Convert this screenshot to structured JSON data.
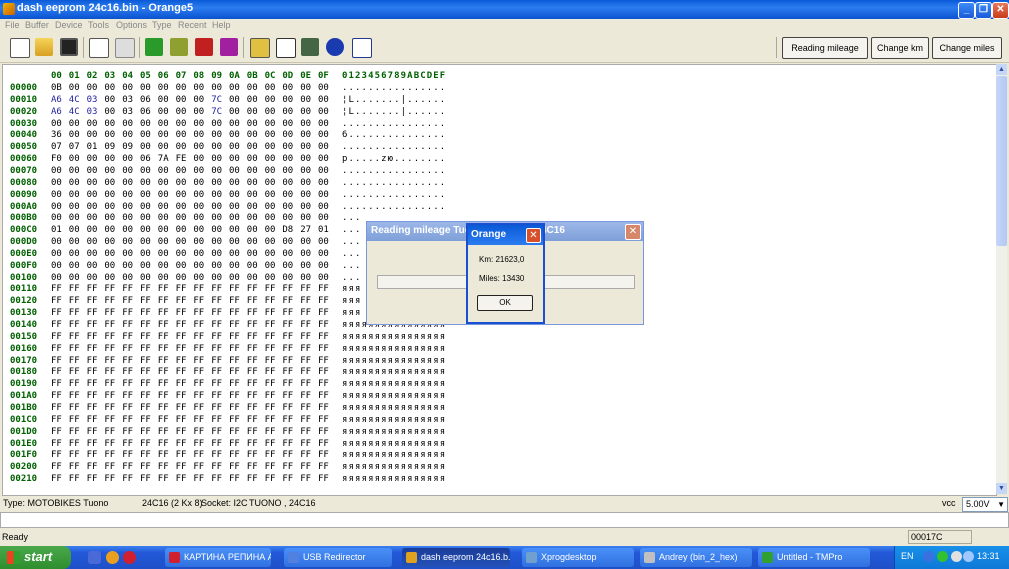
{
  "window": {
    "title": "dash eeprom 24c16.bin - Orange5"
  },
  "menu": [
    "File",
    "Buffer",
    "Device",
    "Tools",
    "Options",
    "Type",
    "Recent",
    "Help"
  ],
  "toolbar": {
    "reading_mileage": "Reading mileage",
    "change_km": "Change km",
    "change_miles": "Change miles"
  },
  "hex": {
    "header_cols": [
      "00",
      "01",
      "02",
      "03",
      "04",
      "05",
      "06",
      "07",
      "08",
      "09",
      "0A",
      "0B",
      "0C",
      "0D",
      "0E",
      "0F"
    ],
    "header_ascii": "0123456789ABCDEF",
    "rows": [
      {
        "addr": "00000",
        "bytes": [
          "0B",
          "00",
          "00",
          "00",
          "00",
          "00",
          "00",
          "00",
          "00",
          "00",
          "00",
          "00",
          "00",
          "00",
          "00",
          "00"
        ],
        "ascii": "................"
      },
      {
        "addr": "00010",
        "bytes": [
          "A6",
          "4C",
          "03",
          "00",
          "03",
          "06",
          "00",
          "00",
          "00",
          "7C",
          "00",
          "00",
          "00",
          "00",
          "00",
          "00"
        ],
        "ascii": "¦L.......|......"
      },
      {
        "addr": "00020",
        "bytes": [
          "A6",
          "4C",
          "03",
          "00",
          "03",
          "06",
          "00",
          "00",
          "00",
          "7C",
          "00",
          "00",
          "00",
          "00",
          "00",
          "00"
        ],
        "ascii": "¦L.......|......"
      },
      {
        "addr": "00030",
        "bytes": [
          "00",
          "00",
          "00",
          "00",
          "00",
          "00",
          "00",
          "00",
          "00",
          "00",
          "00",
          "00",
          "00",
          "00",
          "00",
          "00"
        ],
        "ascii": "................"
      },
      {
        "addr": "00040",
        "bytes": [
          "36",
          "00",
          "00",
          "00",
          "00",
          "00",
          "00",
          "00",
          "00",
          "00",
          "00",
          "00",
          "00",
          "00",
          "00",
          "00"
        ],
        "ascii": "6..............."
      },
      {
        "addr": "00050",
        "bytes": [
          "07",
          "07",
          "01",
          "09",
          "09",
          "00",
          "00",
          "00",
          "00",
          "00",
          "00",
          "00",
          "00",
          "00",
          "00",
          "00"
        ],
        "ascii": "................"
      },
      {
        "addr": "00060",
        "bytes": [
          "F0",
          "00",
          "00",
          "00",
          "00",
          "06",
          "7A",
          "FE",
          "00",
          "00",
          "00",
          "00",
          "00",
          "00",
          "00",
          "00"
        ],
        "ascii": "p.....zю........"
      },
      {
        "addr": "00070",
        "bytes": [
          "00",
          "00",
          "00",
          "00",
          "00",
          "00",
          "00",
          "00",
          "00",
          "00",
          "00",
          "00",
          "00",
          "00",
          "00",
          "00"
        ],
        "ascii": "................"
      },
      {
        "addr": "00080",
        "bytes": [
          "00",
          "00",
          "00",
          "00",
          "00",
          "00",
          "00",
          "00",
          "00",
          "00",
          "00",
          "00",
          "00",
          "00",
          "00",
          "00"
        ],
        "ascii": "................"
      },
      {
        "addr": "00090",
        "bytes": [
          "00",
          "00",
          "00",
          "00",
          "00",
          "00",
          "00",
          "00",
          "00",
          "00",
          "00",
          "00",
          "00",
          "00",
          "00",
          "00"
        ],
        "ascii": "................"
      },
      {
        "addr": "000A0",
        "bytes": [
          "00",
          "00",
          "00",
          "00",
          "00",
          "00",
          "00",
          "00",
          "00",
          "00",
          "00",
          "00",
          "00",
          "00",
          "00",
          "00"
        ],
        "ascii": "................"
      },
      {
        "addr": "000B0",
        "bytes": [
          "00",
          "00",
          "00",
          "00",
          "00",
          "00",
          "00",
          "00",
          "00",
          "00",
          "00",
          "00",
          "00",
          "00",
          "00",
          "00"
        ],
        "ascii": "..."
      },
      {
        "addr": "000C0",
        "bytes": [
          "01",
          "00",
          "00",
          "00",
          "00",
          "00",
          "00",
          "00",
          "00",
          "00",
          "00",
          "00",
          "00",
          "D8",
          "27",
          "01"
        ],
        "ascii": "..."
      },
      {
        "addr": "000D0",
        "bytes": [
          "00",
          "00",
          "00",
          "00",
          "00",
          "00",
          "00",
          "00",
          "00",
          "00",
          "00",
          "00",
          "00",
          "00",
          "00",
          "00"
        ],
        "ascii": "..."
      },
      {
        "addr": "000E0",
        "bytes": [
          "00",
          "00",
          "00",
          "00",
          "00",
          "00",
          "00",
          "00",
          "00",
          "00",
          "00",
          "00",
          "00",
          "00",
          "00",
          "00"
        ],
        "ascii": "..."
      },
      {
        "addr": "000F0",
        "bytes": [
          "00",
          "00",
          "00",
          "00",
          "00",
          "00",
          "00",
          "00",
          "00",
          "00",
          "00",
          "00",
          "00",
          "00",
          "00",
          "00"
        ],
        "ascii": "..."
      },
      {
        "addr": "00100",
        "bytes": [
          "00",
          "00",
          "00",
          "00",
          "00",
          "00",
          "00",
          "00",
          "00",
          "00",
          "00",
          "00",
          "00",
          "00",
          "00",
          "00"
        ],
        "ascii": "..."
      },
      {
        "addr": "00110",
        "bytes": [
          "FF",
          "FF",
          "FF",
          "FF",
          "FF",
          "FF",
          "FF",
          "FF",
          "FF",
          "FF",
          "FF",
          "FF",
          "FF",
          "FF",
          "FF",
          "FF"
        ],
        "ascii": "яяя"
      },
      {
        "addr": "00120",
        "bytes": [
          "FF",
          "FF",
          "FF",
          "FF",
          "FF",
          "FF",
          "FF",
          "FF",
          "FF",
          "FF",
          "FF",
          "FF",
          "FF",
          "FF",
          "FF",
          "FF"
        ],
        "ascii": "яяя"
      },
      {
        "addr": "00130",
        "bytes": [
          "FF",
          "FF",
          "FF",
          "FF",
          "FF",
          "FF",
          "FF",
          "FF",
          "FF",
          "FF",
          "FF",
          "FF",
          "FF",
          "FF",
          "FF",
          "FF"
        ],
        "ascii": "яяя"
      },
      {
        "addr": "00140",
        "bytes": [
          "FF",
          "FF",
          "FF",
          "FF",
          "FF",
          "FF",
          "FF",
          "FF",
          "FF",
          "FF",
          "FF",
          "FF",
          "FF",
          "FF",
          "FF",
          "FF"
        ],
        "ascii": "яяяяяяяяяяяяяяяя"
      },
      {
        "addr": "00150",
        "bytes": [
          "FF",
          "FF",
          "FF",
          "FF",
          "FF",
          "FF",
          "FF",
          "FF",
          "FF",
          "FF",
          "FF",
          "FF",
          "FF",
          "FF",
          "FF",
          "FF"
        ],
        "ascii": "яяяяяяяяяяяяяяяя"
      },
      {
        "addr": "00160",
        "bytes": [
          "FF",
          "FF",
          "FF",
          "FF",
          "FF",
          "FF",
          "FF",
          "FF",
          "FF",
          "FF",
          "FF",
          "FF",
          "FF",
          "FF",
          "FF",
          "FF"
        ],
        "ascii": "яяяяяяяяяяяяяяяя"
      },
      {
        "addr": "00170",
        "bytes": [
          "FF",
          "FF",
          "FF",
          "FF",
          "FF",
          "FF",
          "FF",
          "FF",
          "FF",
          "FF",
          "FF",
          "FF",
          "FF",
          "FF",
          "FF",
          "FF"
        ],
        "ascii": "яяяяяяяяяяяяяяяя"
      },
      {
        "addr": "00180",
        "bytes": [
          "FF",
          "FF",
          "FF",
          "FF",
          "FF",
          "FF",
          "FF",
          "FF",
          "FF",
          "FF",
          "FF",
          "FF",
          "FF",
          "FF",
          "FF",
          "FF"
        ],
        "ascii": "яяяяяяяяяяяяяяяя"
      },
      {
        "addr": "00190",
        "bytes": [
          "FF",
          "FF",
          "FF",
          "FF",
          "FF",
          "FF",
          "FF",
          "FF",
          "FF",
          "FF",
          "FF",
          "FF",
          "FF",
          "FF",
          "FF",
          "FF"
        ],
        "ascii": "яяяяяяяяяяяяяяяя"
      },
      {
        "addr": "001A0",
        "bytes": [
          "FF",
          "FF",
          "FF",
          "FF",
          "FF",
          "FF",
          "FF",
          "FF",
          "FF",
          "FF",
          "FF",
          "FF",
          "FF",
          "FF",
          "FF",
          "FF"
        ],
        "ascii": "яяяяяяяяяяяяяяяя"
      },
      {
        "addr": "001B0",
        "bytes": [
          "FF",
          "FF",
          "FF",
          "FF",
          "FF",
          "FF",
          "FF",
          "FF",
          "FF",
          "FF",
          "FF",
          "FF",
          "FF",
          "FF",
          "FF",
          "FF"
        ],
        "ascii": "яяяяяяяяяяяяяяяя"
      },
      {
        "addr": "001C0",
        "bytes": [
          "FF",
          "FF",
          "FF",
          "FF",
          "FF",
          "FF",
          "FF",
          "FF",
          "FF",
          "FF",
          "FF",
          "FF",
          "FF",
          "FF",
          "FF",
          "FF"
        ],
        "ascii": "яяяяяяяяяяяяяяяя"
      },
      {
        "addr": "001D0",
        "bytes": [
          "FF",
          "FF",
          "FF",
          "FF",
          "FF",
          "FF",
          "FF",
          "FF",
          "FF",
          "FF",
          "FF",
          "FF",
          "FF",
          "FF",
          "FF",
          "FF"
        ],
        "ascii": "яяяяяяяяяяяяяяяя"
      },
      {
        "addr": "001E0",
        "bytes": [
          "FF",
          "FF",
          "FF",
          "FF",
          "FF",
          "FF",
          "FF",
          "FF",
          "FF",
          "FF",
          "FF",
          "FF",
          "FF",
          "FF",
          "FF",
          "FF"
        ],
        "ascii": "яяяяяяяяяяяяяяяя"
      },
      {
        "addr": "001F0",
        "bytes": [
          "FF",
          "FF",
          "FF",
          "FF",
          "FF",
          "FF",
          "FF",
          "FF",
          "FF",
          "FF",
          "FF",
          "FF",
          "FF",
          "FF",
          "FF",
          "FF"
        ],
        "ascii": "яяяяяяяяяяяяяяяя"
      },
      {
        "addr": "00200",
        "bytes": [
          "FF",
          "FF",
          "FF",
          "FF",
          "FF",
          "FF",
          "FF",
          "FF",
          "FF",
          "FF",
          "FF",
          "FF",
          "FF",
          "FF",
          "FF",
          "FF"
        ],
        "ascii": "яяяяяяяяяяяяяяяя"
      },
      {
        "addr": "00210",
        "bytes": [
          "FF",
          "FF",
          "FF",
          "FF",
          "FF",
          "FF",
          "FF",
          "FF",
          "FF",
          "FF",
          "FF",
          "FF",
          "FF",
          "FF",
          "FF",
          "FF"
        ],
        "ascii": "яяяяяяяяяяяяяяяя"
      }
    ]
  },
  "info": {
    "type": "Type: MOTOBIKES Tuono",
    "chip": "24C16 (2 Kx 8)",
    "socket": "Socket: I2C",
    "model": "TUONO , 24C16",
    "vcc_label": "vcc",
    "vcc_value": "5.00V"
  },
  "status": {
    "ready": "Ready",
    "address": "00017C"
  },
  "dialog_back": {
    "title": "Reading mileage Tuo",
    "title_tail": "4C16"
  },
  "dialog_front": {
    "title": "Orange",
    "km_line": "Km:  21623,0",
    "miles_line": "Miles:  13430",
    "ok": "OK"
  },
  "taskbar": {
    "start": "start",
    "tasks": [
      {
        "label": "КАРТИНА РЕПИНА А..."
      },
      {
        "label": "USB Redirector"
      },
      {
        "label": "dash eeprom 24c16.b..."
      },
      {
        "label": "Xprogdesktop"
      },
      {
        "label": "Andrey (bin_2_hex)"
      },
      {
        "label": "Untitled - TMPro"
      }
    ],
    "lang": "EN",
    "clock": "13:31"
  }
}
